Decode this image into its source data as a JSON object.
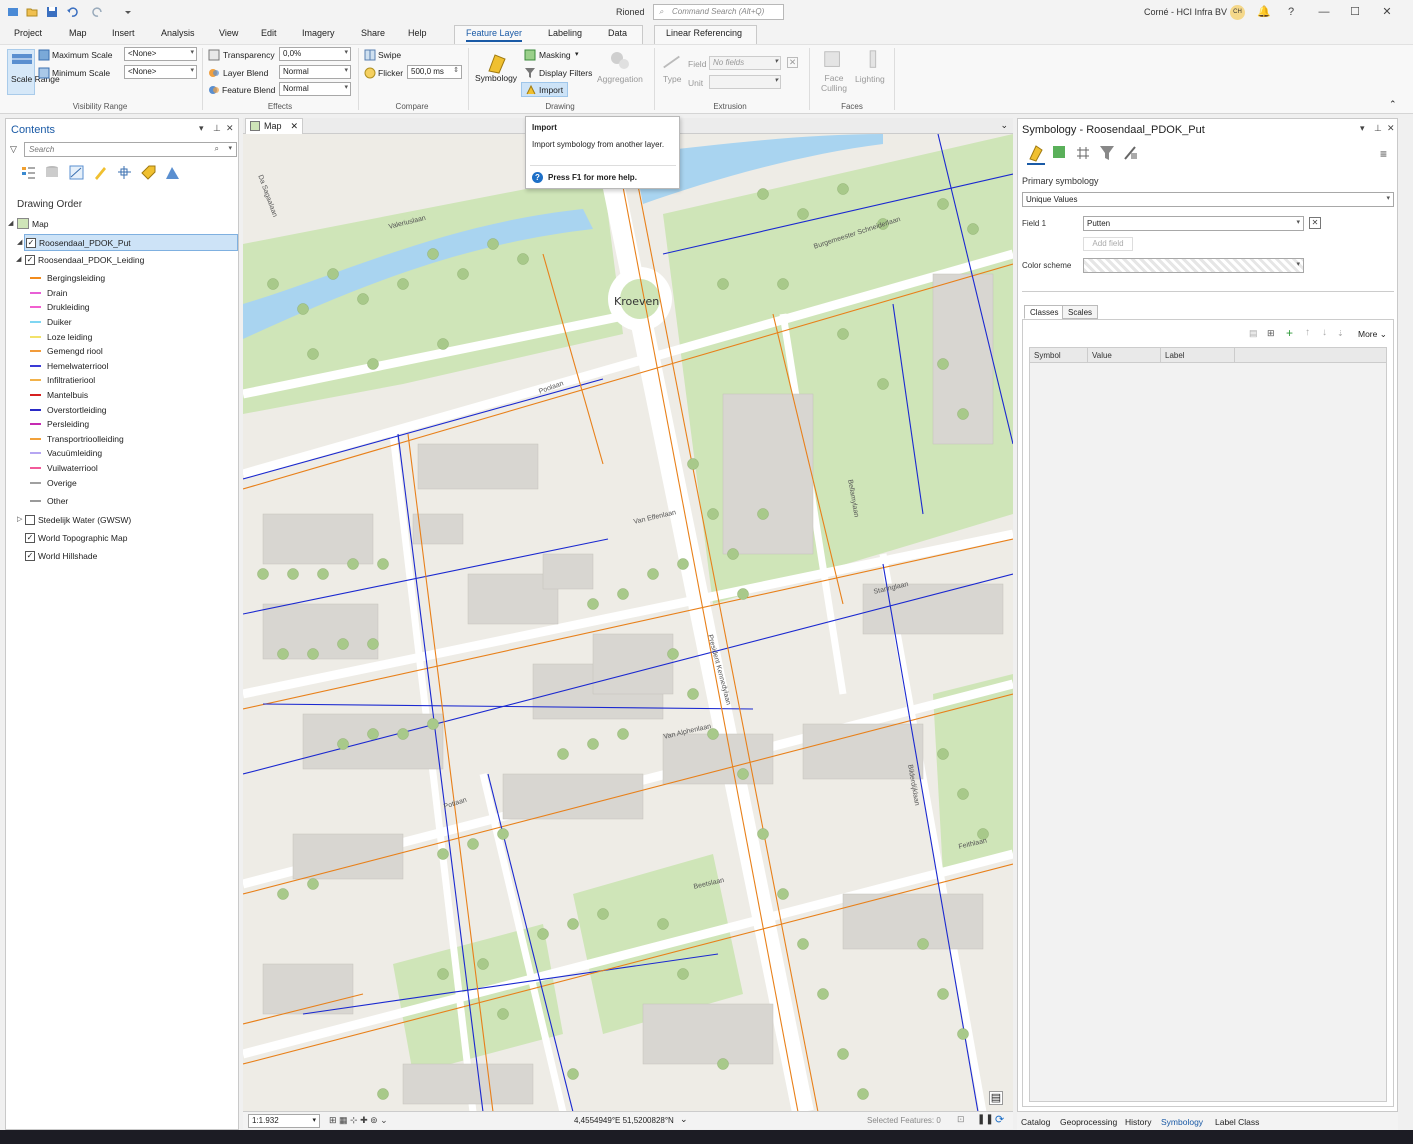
{
  "title_bar": {
    "app_title": "Rioned",
    "search_placeholder": "Command Search (Alt+Q)",
    "user": "Corné - HCI Infra BV",
    "avatar_initials": "CH"
  },
  "ribbon_tabs": [
    "Project",
    "Map",
    "Insert",
    "Analysis",
    "View",
    "Edit",
    "Imagery",
    "Share",
    "Help"
  ],
  "contextual_tabs": {
    "feature_layer": "Feature Layer",
    "labeling": "Labeling",
    "data": "Data",
    "linear_referencing": "Linear Referencing"
  },
  "ribbon": {
    "visibility": {
      "scale_range": "Scale Range",
      "max_scale_label": "Maximum Scale",
      "max_scale_value": "<None>",
      "min_scale_label": "Minimum Scale",
      "min_scale_value": "<None>",
      "group": "Visibility Range"
    },
    "effects": {
      "transparency_label": "Transparency",
      "transparency_value": "0,0%",
      "layer_blend_label": "Layer Blend",
      "layer_blend_value": "Normal",
      "feature_blend_label": "Feature Blend",
      "feature_blend_value": "Normal",
      "group": "Effects"
    },
    "compare": {
      "swipe": "Swipe",
      "flicker_label": "Flicker",
      "flicker_value": "500,0  ms",
      "group": "Compare"
    },
    "drawing": {
      "symbology": "Symbology",
      "masking": "Masking",
      "display_filters": "Display Filters",
      "import": "Import",
      "aggregation": "Aggregation",
      "group": "Drawing"
    },
    "extrusion": {
      "type": "Type",
      "field_label": "Field",
      "field_value": "No fields",
      "unit_label": "Unit",
      "group": "Extrusion"
    },
    "faces": {
      "face_culling": "Face Culling",
      "lighting": "Lighting",
      "group": "Faces"
    }
  },
  "tooltip": {
    "title": "Import",
    "body": "Import symbology from another layer.",
    "help": "Press F1 for more help."
  },
  "contents": {
    "title": "Contents",
    "search_placeholder": "Search",
    "heading": "Drawing Order",
    "map_label": "Map",
    "layers": [
      {
        "name": "Roosendaal_PDOK_Put",
        "checked": true
      },
      {
        "name": "Roosendaal_PDOK_Leiding",
        "checked": true
      },
      {
        "name": "Stedelijk Water (GWSW)",
        "checked": false
      },
      {
        "name": "World Topographic Map",
        "checked": true
      },
      {
        "name": "World Hillshade",
        "checked": true
      }
    ],
    "legend": [
      {
        "label": "Bergingsleiding",
        "color": "#f28b1c"
      },
      {
        "label": "Drain",
        "color": "#e85fd6"
      },
      {
        "label": "Drukleiding",
        "color": "#f25fd0"
      },
      {
        "label": "Duiker",
        "color": "#7fd6f2"
      },
      {
        "label": "Loze leiding",
        "color": "#f2e26a"
      },
      {
        "label": "Gemengd riool",
        "color": "#f29b3a"
      },
      {
        "label": "Hemelwaterriool",
        "color": "#3a3ad6"
      },
      {
        "label": "Infiltratieriool",
        "color": "#f2b24a"
      },
      {
        "label": "Mantelbuis",
        "color": "#d62020"
      },
      {
        "label": "Overstortleiding",
        "color": "#2a2ac6"
      },
      {
        "label": "Persleiding",
        "color": "#c62ab2"
      },
      {
        "label": "Transportrioolleiding",
        "color": "#f2a13a"
      },
      {
        "label": "Vacuümleiding",
        "color": "#b6a6f2"
      },
      {
        "label": "Vuilwaterriool",
        "color": "#f25a9a"
      },
      {
        "label": "Overige",
        "color": "#a0a0a0"
      },
      {
        "label": "Other",
        "color": "#9a9a9a"
      }
    ]
  },
  "map": {
    "tab_label": "Map",
    "scale": "1:1.932",
    "coordinates": "4,4554949°E 51,5200828°N",
    "selected_features": "Selected Features: 0",
    "place_label": "Kroeven",
    "street_labels": [
      "Valeriuslaan",
      "Burgemeester Schneiderlaan",
      "Poolaan",
      "Van Effenlaan",
      "President Kennedylaan",
      "Bellamylaan",
      "Staringlaan",
      "Van Alphenlaan",
      "Bilderdijklaan",
      "Potlaan",
      "Feithlaan",
      "Beetslaan",
      "Da Sagaalaan"
    ]
  },
  "symbology": {
    "title": "Symbology - Roosendaal_PDOK_Put",
    "primary_label": "Primary symbology",
    "method": "Unique Values",
    "field1_label": "Field 1",
    "field1_value": "Putten",
    "add_field": "Add field",
    "color_scheme_label": "Color scheme",
    "tabs": [
      "Classes",
      "Scales"
    ],
    "more": "More",
    "columns": [
      "Symbol",
      "Value",
      "Label"
    ]
  },
  "pane_tabs": [
    "Catalog",
    "Geoprocessing",
    "History",
    "Symbology",
    "Label Class"
  ],
  "colors": {
    "accent": "#1a5aa6",
    "water": "#a9d4f0",
    "park": "#cfe5b8",
    "building": "#d8d6d1",
    "pipe_blue": "#1a28d0",
    "pipe_orange": "#e8801a"
  }
}
